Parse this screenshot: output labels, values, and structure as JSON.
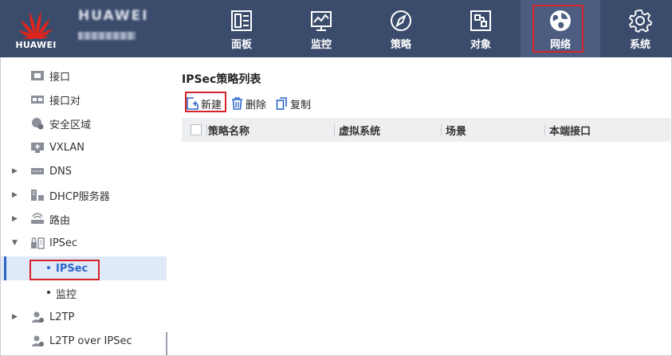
{
  "header": {
    "logo_text": "HUAWEI",
    "brand_name": "HUAWEI",
    "nav": [
      {
        "label": "面板",
        "icon": "dashboard-icon"
      },
      {
        "label": "监控",
        "icon": "monitor-icon"
      },
      {
        "label": "策略",
        "icon": "compass-icon"
      },
      {
        "label": "对象",
        "icon": "object-icon"
      },
      {
        "label": "网络",
        "icon": "globe-icon",
        "active": true
      },
      {
        "label": "系统",
        "icon": "gear-icon"
      }
    ]
  },
  "sidebar": {
    "items": [
      {
        "label": "接口",
        "icon": "interface-icon"
      },
      {
        "label": "接口对",
        "icon": "interface-pair-icon"
      },
      {
        "label": "安全区域",
        "icon": "security-zone-icon"
      },
      {
        "label": "VXLAN",
        "icon": "vxlan-icon"
      },
      {
        "label": "DNS",
        "icon": "dns-icon"
      },
      {
        "label": "DHCP服务器",
        "icon": "dhcp-server-icon"
      },
      {
        "label": "路由",
        "icon": "router-icon"
      },
      {
        "label": "IPSec",
        "icon": "ipsec-icon"
      },
      {
        "label": "IPSec",
        "active": true
      },
      {
        "label": "监控"
      },
      {
        "label": "L2TP",
        "icon": "l2tp-icon"
      },
      {
        "label": "L2TP over IPSec",
        "icon": "l2tp-over-ipsec-icon"
      }
    ]
  },
  "main": {
    "title": "IPSec策略列表",
    "toolbar": {
      "new_label": "新建",
      "delete_label": "删除",
      "copy_label": "复制"
    },
    "table": {
      "columns": [
        "策略名称",
        "虚拟系统",
        "场景",
        "本端接口"
      ],
      "rows": []
    }
  },
  "colors": {
    "header_bg": "#3b4b6c",
    "accent": "#2b67c8",
    "highlight": "#d6232a"
  }
}
